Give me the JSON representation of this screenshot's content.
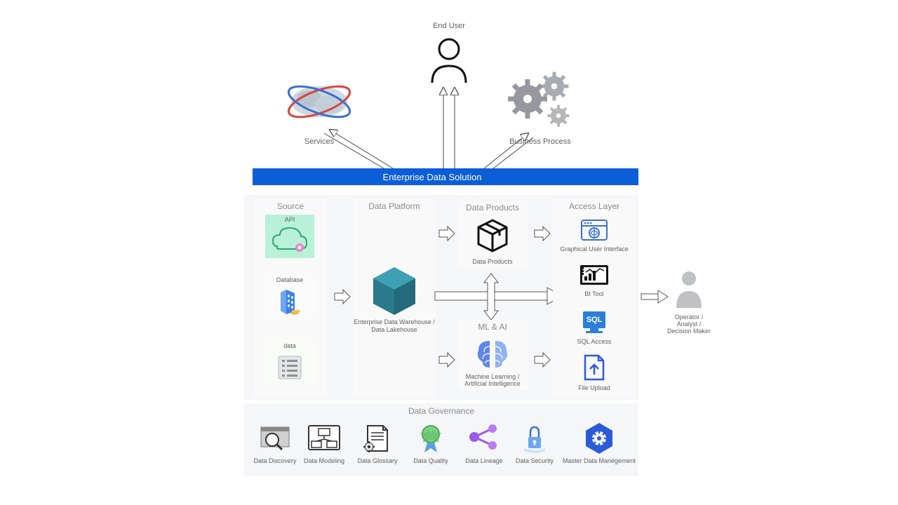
{
  "top": {
    "services": "Services",
    "end_user": "End User",
    "business_process": "Business Process"
  },
  "banner": "Enterprise Data Solution",
  "columns": {
    "source": {
      "header": "Source",
      "api": "API",
      "database": "Database",
      "data": "data"
    },
    "platform": {
      "header": "Data Platform",
      "caption": "Enterprise Data Warehouse /\nData Lakehouse"
    },
    "products": {
      "header": "Data Products",
      "caption": "Data Products",
      "mlai_header": "ML & AI",
      "mlai_caption": "Machine Learning /\nArtificial Intelligence"
    },
    "access": {
      "header": "Access Layer",
      "gui": "Graphical User Interface",
      "bi": "BI Tool",
      "sql": "SQL Access",
      "file": "File Upload"
    }
  },
  "operator": "Operator /\nAnalyst /\nDecision Maker",
  "governance": {
    "header": "Data Governance",
    "items": [
      "Data Discovery",
      "Data Modeling",
      "Data Glossary",
      "Data Quality",
      "Data Lineage",
      "Data Security",
      "Master Data Manegement"
    ]
  },
  "colors": {
    "banner": "#0b5ed7",
    "panel": "#f5f6f7",
    "card": "#fafafa",
    "cube1": "#2a7a8c",
    "cube2": "#3ea0b5",
    "mintA": "#b8f0d8",
    "mintB": "#d8f5e8"
  }
}
